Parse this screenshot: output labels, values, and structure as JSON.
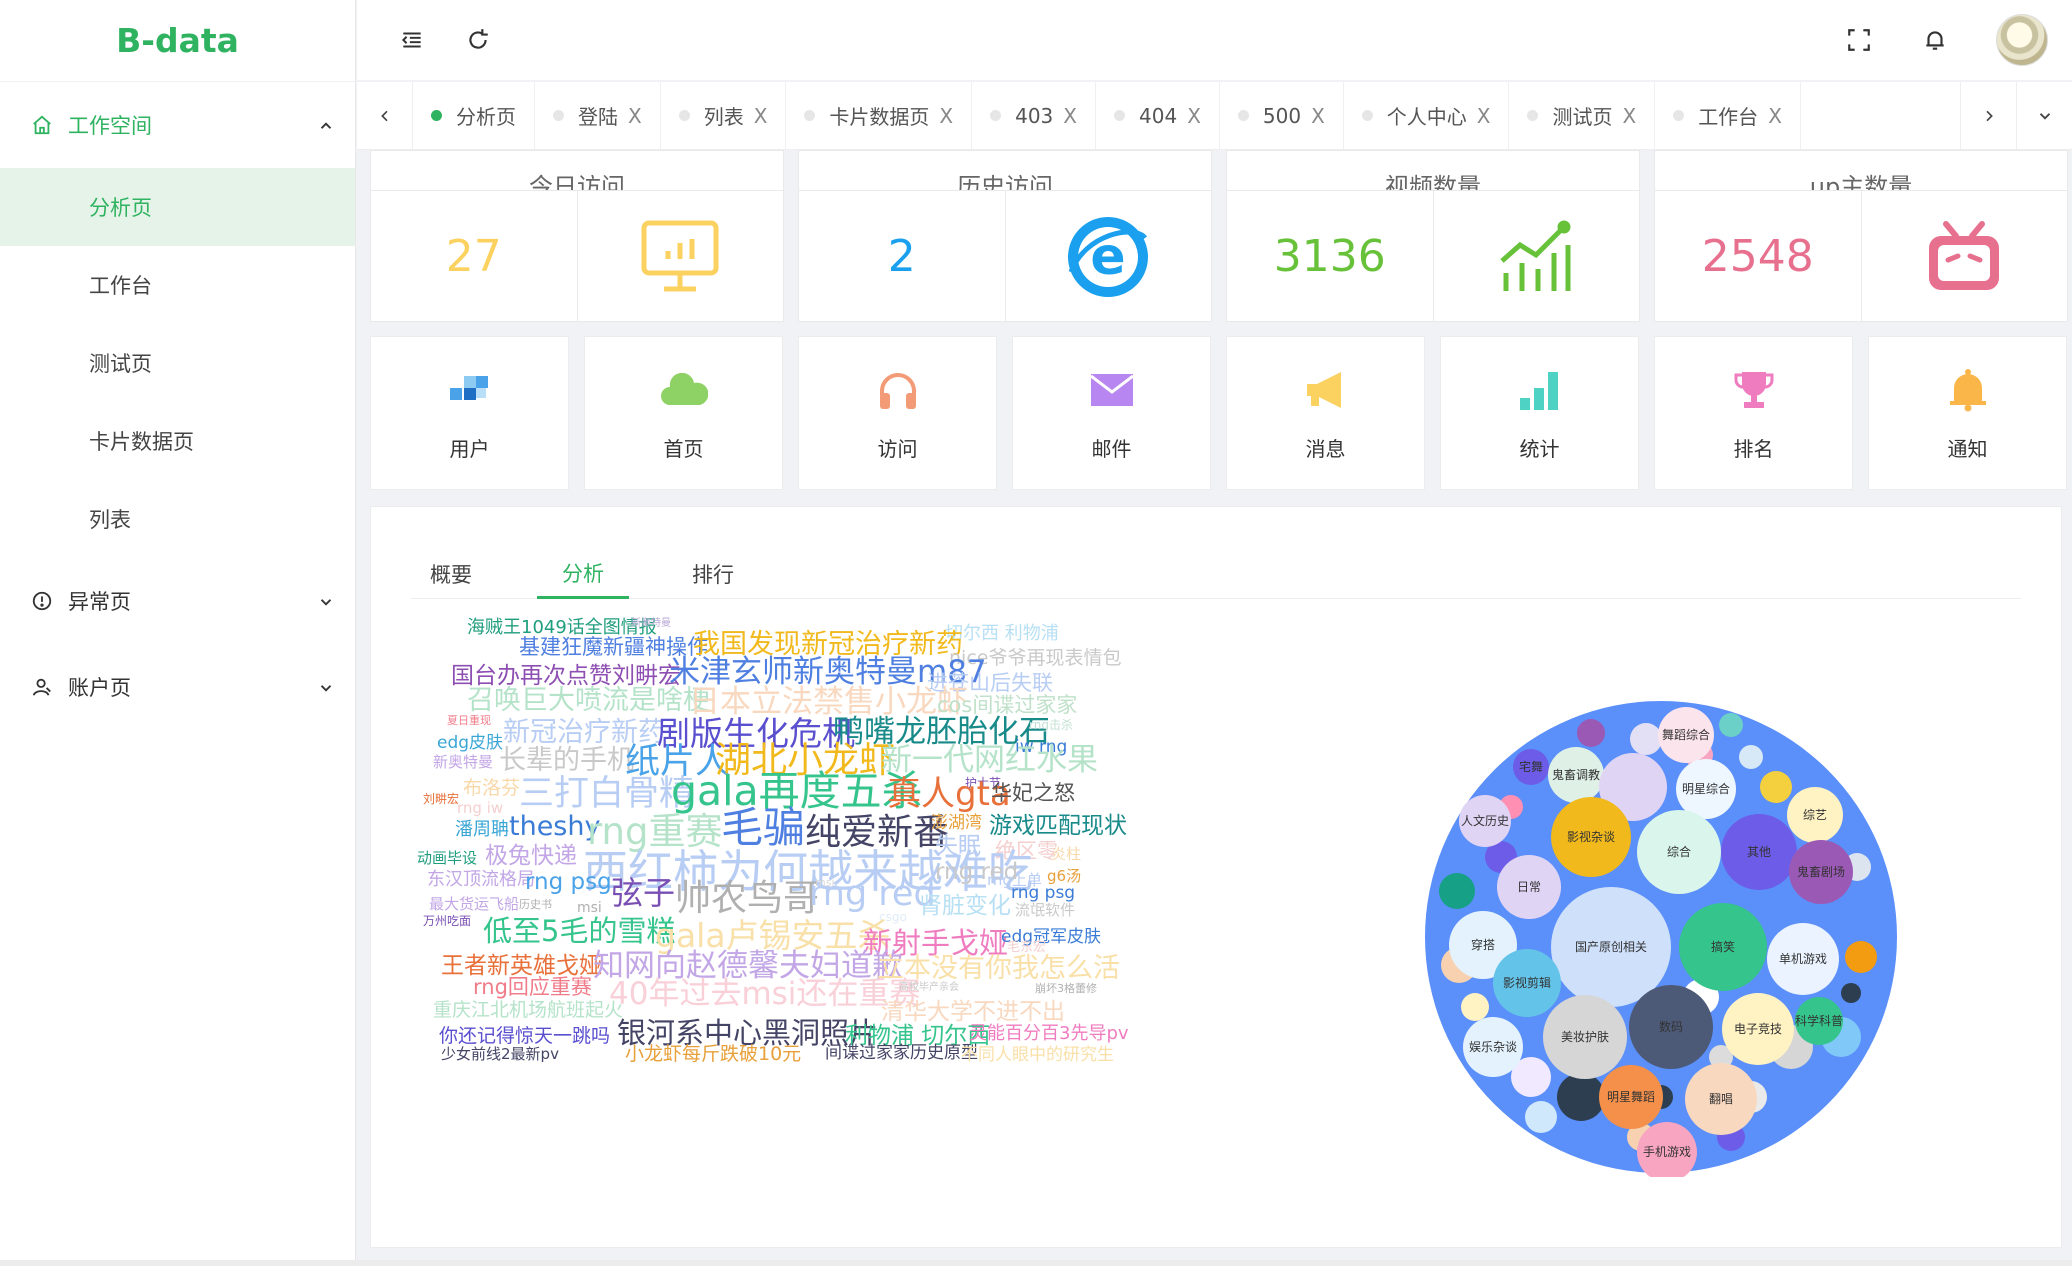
{
  "app": {
    "logo": "B-data"
  },
  "sidebar": {
    "groups": [
      {
        "label": "工作空间",
        "icon": "home-icon",
        "items": [
          "分析页",
          "工作台",
          "测试页",
          "卡片数据页",
          "列表"
        ]
      },
      {
        "label": "异常页",
        "icon": "alert-circle-icon"
      },
      {
        "label": "账户页",
        "icon": "user-icon"
      }
    ],
    "active_item": "分析页"
  },
  "header": {
    "left_icons": [
      "menu-fold-icon",
      "refresh-icon"
    ],
    "right_icons": [
      "fullscreen-icon",
      "bell-icon",
      "avatar"
    ]
  },
  "tabs": [
    {
      "label": "分析页",
      "active": true,
      "closable": false
    },
    {
      "label": "登陆",
      "closable": true
    },
    {
      "label": "列表",
      "closable": true
    },
    {
      "label": "卡片数据页",
      "closable": true
    },
    {
      "label": "403",
      "closable": true
    },
    {
      "label": "404",
      "closable": true
    },
    {
      "label": "500",
      "closable": true
    },
    {
      "label": "个人中心",
      "closable": true
    },
    {
      "label": "测试页",
      "closable": true
    },
    {
      "label": "工作台",
      "closable": true
    }
  ],
  "tab_close_glyph": "X",
  "stats": [
    {
      "title": "今日访问",
      "value": "27",
      "color": "#fbd160",
      "icon": "monitor-chart-icon"
    },
    {
      "title": "历史访问",
      "value": "2",
      "color": "#1aa0ee",
      "icon": "ie-browser-icon"
    },
    {
      "title": "视频数量",
      "value": "3136",
      "color": "#67c23a",
      "icon": "trend-chart-icon"
    },
    {
      "title": "up主数量",
      "value": "2548",
      "color": "#e8708f",
      "icon": "bilibili-tv-icon"
    }
  ],
  "quick_links": [
    {
      "label": "用户",
      "icon": "user-blocks-icon",
      "color": "#4aa3e8"
    },
    {
      "label": "首页",
      "icon": "cloud-icon",
      "color": "#8ed265"
    },
    {
      "label": "访问",
      "icon": "headphones-icon",
      "color": "#f29b76"
    },
    {
      "label": "邮件",
      "icon": "mail-icon",
      "color": "#b886f0"
    },
    {
      "label": "消息",
      "icon": "megaphone-icon",
      "color": "#fbd160"
    },
    {
      "label": "统计",
      "icon": "bar-stats-icon",
      "color": "#4ed2c4"
    },
    {
      "label": "排名",
      "icon": "trophy-icon",
      "color": "#f07cc0"
    },
    {
      "label": "通知",
      "icon": "bell-icon",
      "color": "#fbb64a"
    }
  ],
  "panel_tabs": [
    {
      "label": "概要"
    },
    {
      "label": "分析",
      "active": true
    },
    {
      "label": "排行"
    }
  ],
  "wordcloud": [
    {
      "t": "海贼王1049话全图情报",
      "c": "#1f9e7e",
      "s": 18
    },
    {
      "t": "新奥特曼",
      "c": "#b9a9d6",
      "s": 10
    },
    {
      "t": "切尔西 利物浦",
      "c": "#b8e0f4",
      "s": 18
    },
    {
      "t": "基建狂魔新疆神操作",
      "c": "#4f7fe0",
      "s": 21
    },
    {
      "t": "我国发现新冠治疗新药",
      "c": "#f1b91c",
      "s": 27
    },
    {
      "t": "nice爷爷再现表情包",
      "c": "#c9c9c9",
      "s": 19
    },
    {
      "t": "国台办再次点赞刘畊宏",
      "c": "#8e4fb3",
      "s": 23
    },
    {
      "t": "米津玄师新奥特曼m87",
      "c": "#4f7fe0",
      "s": 31
    },
    {
      "t": "进苍山后失联",
      "c": "#b8cdf4",
      "s": 21
    },
    {
      "t": "召唤巨大喷流是啥梗",
      "c": "#b5e3c9",
      "s": 27
    },
    {
      "t": "日本立法禁售小龙虾",
      "c": "#f9d8c0",
      "s": 31
    },
    {
      "t": "cos间谍过家家",
      "c": "#bfe1c9",
      "s": 21
    },
    {
      "t": "夏日重现",
      "c": "#f07c8a",
      "s": 11
    },
    {
      "t": "新冠治疗新药",
      "c": "#b8cdf4",
      "s": 27
    },
    {
      "t": "剧版生化危机",
      "c": "#5a4fcf",
      "s": 33
    },
    {
      "t": "鸭嘴龙胚胎化石",
      "c": "#188a8a",
      "s": 31
    },
    {
      "t": "rng击杀",
      "c": "#c5e1d6",
      "s": 12
    },
    {
      "t": "edg皮肤",
      "c": "#3aa6d6",
      "s": 17
    },
    {
      "t": "iw rng",
      "c": "#3a7bd6",
      "s": 17
    },
    {
      "t": "新奥特曼",
      "c": "#c2a6e6",
      "s": 15
    },
    {
      "t": "长辈的手机",
      "c": "#c9c9c9",
      "s": 27
    },
    {
      "t": "纸片人",
      "c": "#4aa3e8",
      "s": 35
    },
    {
      "t": "湖北小龙虾",
      "c": "#f1b91c",
      "s": 36
    },
    {
      "t": "新一代网红水果",
      "c": "#b5e3c9",
      "s": 31
    },
    {
      "t": "护士节",
      "c": "#7a4fb3",
      "s": 12
    },
    {
      "t": "刘畊宏",
      "c": "#e8703a",
      "s": 12
    },
    {
      "t": "布洛芬",
      "c": "#f9d8a8",
      "s": 19
    },
    {
      "t": "rng iw",
      "c": "#f4cfcf",
      "s": 15
    },
    {
      "t": "三打白骨精",
      "c": "#b8cdf4",
      "s": 35
    },
    {
      "t": "gala再度五杀",
      "c": "#35c48c",
      "s": 41
    },
    {
      "t": "真人gta",
      "c": "#e8703a",
      "s": 34
    },
    {
      "t": "华妃之怒",
      "c": "#555555",
      "s": 21
    },
    {
      "t": "潘周聃",
      "c": "#3aa6d6",
      "s": 18
    },
    {
      "t": "theshy",
      "c": "#3a7bd6",
      "s": 27
    },
    {
      "t": "rng重赛",
      "c": "#b5e3c9",
      "s": 37
    },
    {
      "t": "毛骗",
      "c": "#4f7fe0",
      "s": 42
    },
    {
      "t": "纯爱新番",
      "c": "#444466",
      "s": 36
    },
    {
      "t": "澎湖湾",
      "c": "#e8a03a",
      "s": 17
    },
    {
      "t": "游戏匹配现状",
      "c": "#188a8a",
      "s": 23
    },
    {
      "t": "动画毕设",
      "c": "#1f9e7e",
      "s": 15
    },
    {
      "t": "极兔快递",
      "c": "#c2a6e6",
      "s": 23
    },
    {
      "t": "失眠",
      "c": "#b8cdf4",
      "s": 23
    },
    {
      "t": "绝区零",
      "c": "#f4cfcf",
      "s": 21
    },
    {
      "t": "炎柱",
      "c": "#f9d8a8",
      "s": 15
    },
    {
      "t": "西红柿为何越来越难吃",
      "c": "#b8cdf4",
      "s": 45
    },
    {
      "t": "rng red",
      "c": "#c9c9c9",
      "s": 23
    },
    {
      "t": "东汉顶流格局",
      "c": "#c2a6e6",
      "s": 18
    },
    {
      "t": "rng上单",
      "c": "#b8cdf4",
      "s": 15
    },
    {
      "t": "g6汤",
      "c": "#e8a03a",
      "s": 15
    },
    {
      "t": "rng psg",
      "c": "#4aa3e8",
      "s": 23
    },
    {
      "t": "msi",
      "c": "#d9d9d9",
      "s": 11
    },
    {
      "t": "弦子",
      "c": "#7a4fb3",
      "s": 32
    },
    {
      "t": "帅农鸟哥",
      "c": "#b0b0b0",
      "s": 36
    },
    {
      "t": "rng red",
      "c": "#b8cdf4",
      "s": 35
    },
    {
      "t": "rng psg",
      "c": "#3a7bd6",
      "s": 17
    },
    {
      "t": "最大货运飞船",
      "c": "#c2a6e6",
      "s": 15
    },
    {
      "t": "历史书",
      "c": "#b0b0b0",
      "s": 11
    },
    {
      "t": "msi",
      "c": "#b0b0b0",
      "s": 14
    },
    {
      "t": "肾脏变化",
      "c": "#b8e0f4",
      "s": 23
    },
    {
      "t": "流氓软件",
      "c": "#c9c9c9",
      "s": 15
    },
    {
      "t": "万州吃面",
      "c": "#7a4fb3",
      "s": 12
    },
    {
      "t": "低至5毛的雪糕",
      "c": "#35c48c",
      "s": 29
    },
    {
      "t": "csgo",
      "c": "#e0ecf8",
      "s": 12
    },
    {
      "t": "gala卢锡安五杀",
      "c": "#f9e0a8",
      "s": 33
    },
    {
      "t": "新射手戈娅",
      "c": "#f07cc0",
      "s": 29
    },
    {
      "t": "edg冠军皮肤",
      "c": "#3a7bd6",
      "s": 17
    },
    {
      "t": "毛东宏",
      "c": "#f4cfcf",
      "s": 13
    },
    {
      "t": "王者新英雄戈娅",
      "c": "#e8703a",
      "s": 23
    },
    {
      "t": "知网向赵德馨夫妇道歉",
      "c": "#c2a6e6",
      "s": 31
    },
    {
      "t": "立本没有你我怎么活",
      "c": "#f9e0a8",
      "s": 27
    },
    {
      "t": "rng回应重赛",
      "c": "#f07c8a",
      "s": 21
    },
    {
      "t": "40年过去msi还在重赛",
      "c": "#f9d0d8",
      "s": 31
    },
    {
      "t": "高校毕产亲会",
      "c": "#c9c9c9",
      "s": 10
    },
    {
      "t": "崩坏3格蕾修",
      "c": "#b0b0b0",
      "s": 11
    },
    {
      "t": "重庆江北机场航班起火",
      "c": "#b5e3c9",
      "s": 19
    },
    {
      "t": "清华大学不进不出",
      "c": "#f9d8c0",
      "s": 23
    },
    {
      "t": "你还记得惊天一跳吗",
      "c": "#5a4fcf",
      "s": 19
    },
    {
      "t": "银河系中心黑洞照片",
      "c": "#444466",
      "s": 29
    },
    {
      "t": "利物浦 切尔西",
      "c": "#35c48c",
      "s": 23
    },
    {
      "t": "灵能百分百3先导pv",
      "c": "#f07cc0",
      "s": 18
    },
    {
      "t": "少女前线2最新pv",
      "c": "#444466",
      "s": 15
    },
    {
      "t": "小龙虾每斤跌破10元",
      "c": "#e8a03a",
      "s": 19
    },
    {
      "t": "间谍过家家历史原型",
      "c": "#444466",
      "s": 17
    },
    {
      "t": "不同人眼中的研究生",
      "c": "#f9e0a8",
      "s": 17
    }
  ],
  "bubble_labels": [
    "舞蹈综合",
    "宅舞",
    "鬼畜调教",
    "明星综合",
    "人文历史",
    "影视杂谈",
    "综艺",
    "综合",
    "其他",
    "鬼畜剧场",
    "日常",
    "穿搭",
    "国产原创相关",
    "搞笑",
    "单机游戏",
    "影视剪辑",
    "数码",
    "电子竞技",
    "科学科普",
    "娱乐杂谈",
    "美妆护肤",
    "明星舞蹈",
    "翻唱",
    "手机游戏"
  ],
  "colors": {
    "brand": "#2fb360",
    "active_bg": "#e6f3e9",
    "bubble_outer": "#5b8ff9"
  }
}
